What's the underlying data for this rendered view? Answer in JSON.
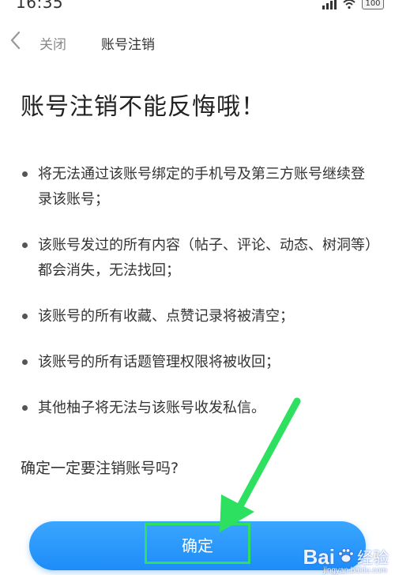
{
  "status_bar": {
    "time": "16:35",
    "battery_level": "100"
  },
  "nav": {
    "close_label": "关闭",
    "title": "账号注销"
  },
  "headline": "账号注销不能反悔哦！",
  "bullets": [
    "将无法通过该账号绑定的手机号及第三方账号继续登录该账号；",
    "该账号发过的所有内容（帖子、评论、动态、树洞等）都会消失，无法找回；",
    "该账号的所有收藏、点赞记录将被清空；",
    "该账号的所有话题管理权限将被收回；",
    "其他柚子将无法与该账号收发私信。"
  ],
  "question": "确定一定要注销账号吗?",
  "confirm_button": {
    "label": "确定"
  },
  "overlays": {
    "highlight_color": "#2ee05f",
    "arrow_color": "#2ee05f"
  },
  "watermark": {
    "brand": "Bai",
    "side_text": "经验",
    "url": "jingyan.baidu.com"
  },
  "colors": {
    "primary": "#1e8cf8",
    "text": "#333333",
    "muted": "#888888"
  }
}
